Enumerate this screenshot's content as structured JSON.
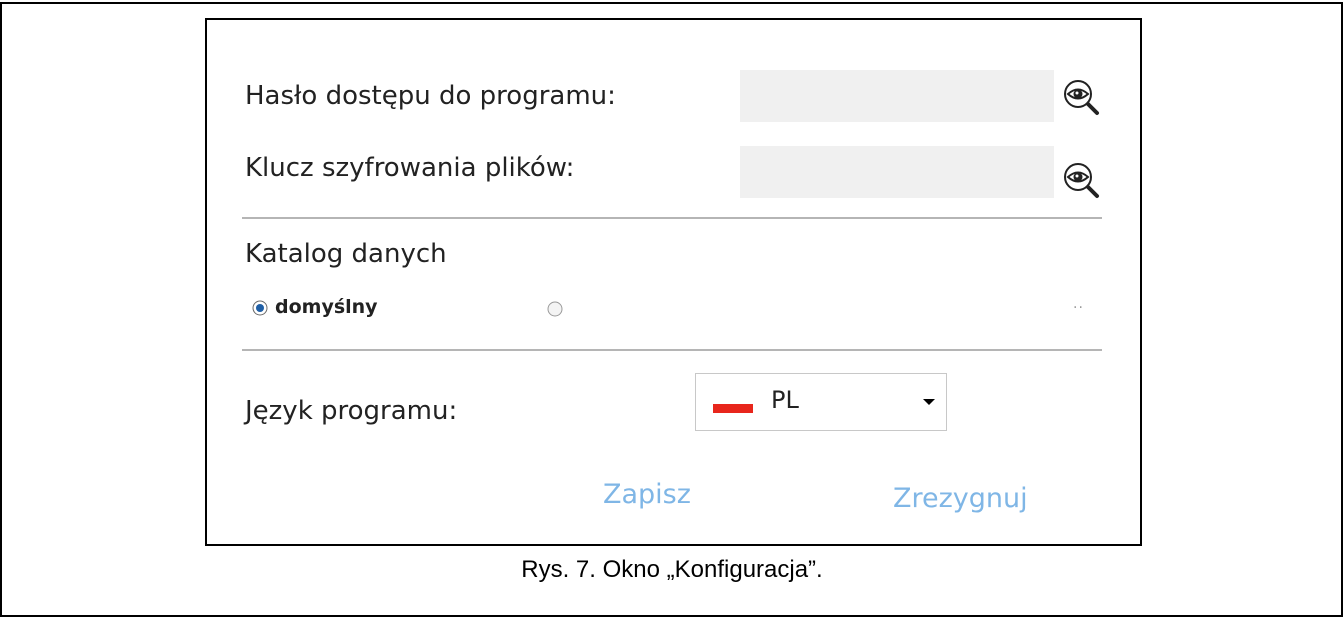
{
  "dialog": {
    "password_label": "Hasło dostępu do programu:",
    "password_value": "",
    "password_reveal_icon": "eye-magnifier-icon",
    "encryption_label": "Klucz szyfrowania plików:",
    "encryption_value": "",
    "encryption_reveal_icon": "eye-magnifier-icon",
    "data_dir_heading": "Katalog danych",
    "data_dir_options": [
      {
        "label": "domyślny",
        "selected": true
      },
      {
        "label": "",
        "selected": false
      }
    ],
    "browse_label": "··",
    "language_label": "Język programu:",
    "language_selected": "PL",
    "language_flag_color": "#e8261c",
    "save_label": "Zapisz",
    "cancel_label": "Zrezygnuj",
    "button_color": "#7fb6e6"
  },
  "caption": "Rys. 7. Okno „Konfiguracja”."
}
